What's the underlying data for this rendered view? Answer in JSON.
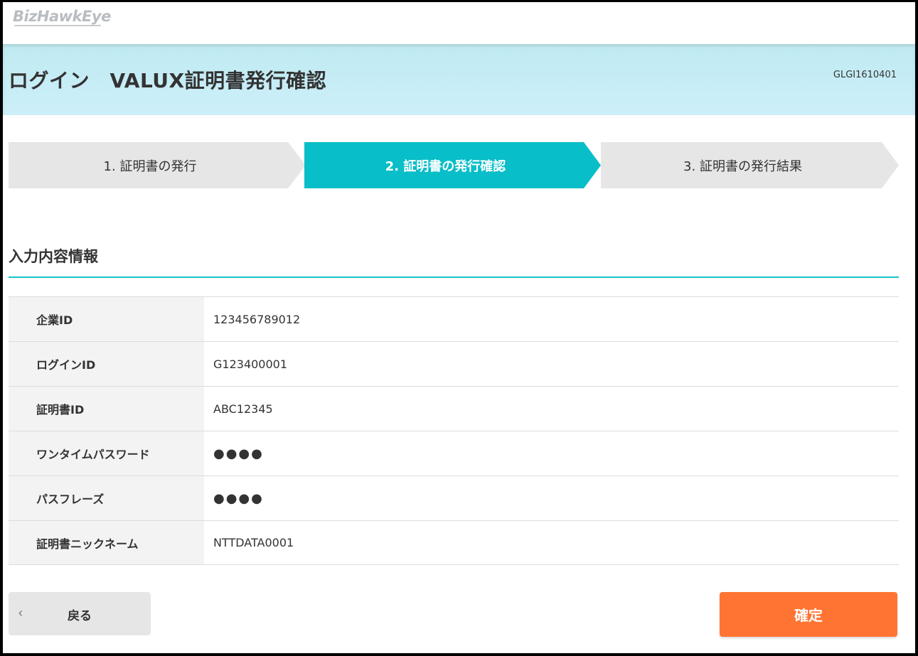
{
  "brand": {
    "logo_text": "BizHawkEye"
  },
  "header": {
    "title": "ログイン　VALUX証明書発行確認",
    "screen_id": "GLGI1610401"
  },
  "steps": [
    {
      "label": "1. 証明書の発行",
      "state": "done"
    },
    {
      "label": "2. 証明書の発行確認",
      "state": "current"
    },
    {
      "label": "3. 証明書の発行結果",
      "state": "upcoming"
    }
  ],
  "section": {
    "title": "入力内容情報"
  },
  "fields": [
    {
      "label": "企業ID",
      "value": "123456789012"
    },
    {
      "label": "ログインID",
      "value": "G123400001"
    },
    {
      "label": "証明書ID",
      "value": "ABC12345"
    },
    {
      "label": "ワンタイムパスワード",
      "value": "●●●●"
    },
    {
      "label": "パスフレーズ",
      "value": "●●●●"
    },
    {
      "label": "証明書ニックネーム",
      "value": "NTTDATA0001"
    }
  ],
  "buttons": {
    "back_label": "戻る",
    "back_icon": "chevron-left-icon",
    "back_glyph": "‹",
    "confirm_label": "確定"
  },
  "colors": {
    "active_step": "#08bec8",
    "accent_rule": "#19c1cc",
    "confirm_button": "#ff7433",
    "title_band": "#c9eef8"
  }
}
